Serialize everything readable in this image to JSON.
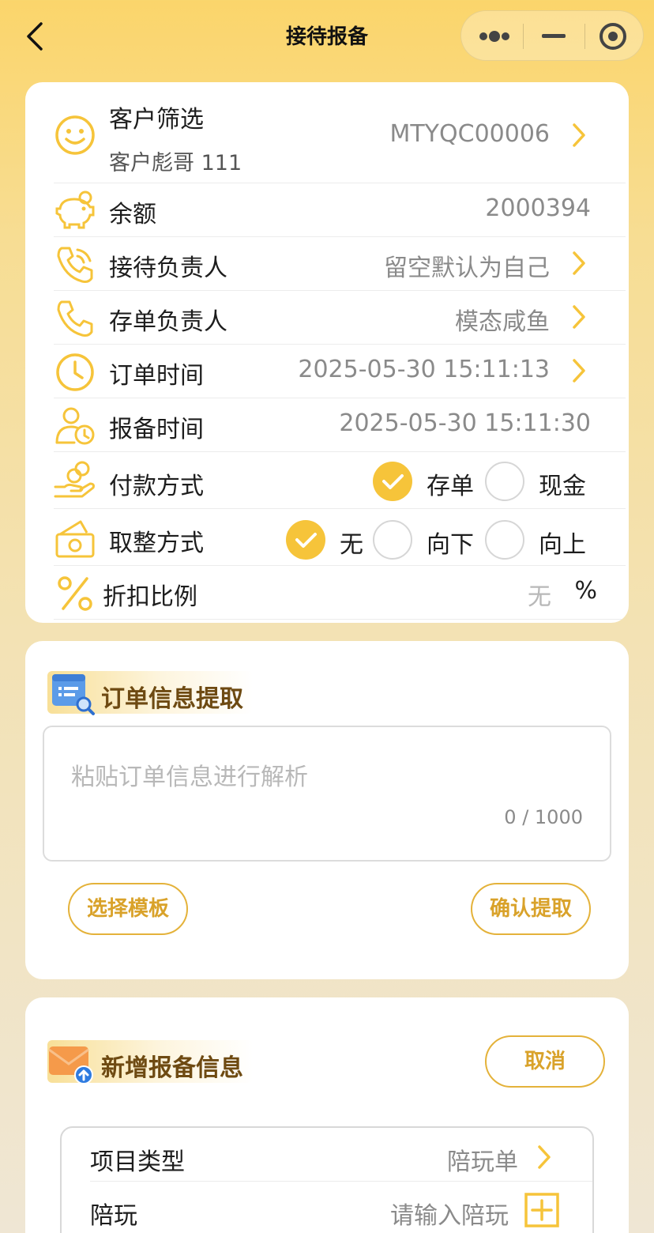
{
  "header": {
    "title": "接待报备",
    "back_icon": "chevron-left-icon",
    "menu_icons": [
      "more-dots-icon",
      "minimize-icon",
      "close-circle-icon"
    ]
  },
  "colors": {
    "accent": "#F6C43A",
    "accent_text": "#D9A22A",
    "section_title": "#6E4A12"
  },
  "customer": {
    "label": "客户筛选",
    "name": "客户彪哥 111",
    "code": "MTYQC00006"
  },
  "balance": {
    "label": "余额",
    "value": "2000394"
  },
  "reception_owner": {
    "label": "接待负责人",
    "value": "留空默认为自己"
  },
  "deposit_owner": {
    "label": "存单负责人",
    "value": "模态咸鱼"
  },
  "order_time": {
    "label": "订单时间",
    "value": "2025-05-30 15:11:13"
  },
  "report_time": {
    "label": "报备时间",
    "value": "2025-05-30 15:11:30"
  },
  "payment": {
    "label": "付款方式",
    "options": [
      "存单",
      "现金"
    ],
    "selected": "存单"
  },
  "rounding": {
    "label": "取整方式",
    "options": [
      "无",
      "向下",
      "向上"
    ],
    "selected": "无"
  },
  "discount": {
    "label": "折扣比例",
    "value": "无",
    "unit": "%"
  },
  "order_extract": {
    "title": "订单信息提取",
    "placeholder": "粘贴订单信息进行解析",
    "counter": "0 / 1000",
    "select_template": "选择模板",
    "confirm_extract": "确认提取"
  },
  "new_report": {
    "title": "新增报备信息",
    "cancel": "取消",
    "project_type": {
      "label": "项目类型",
      "value": "陪玩单"
    },
    "companion": {
      "label": "陪玩",
      "placeholder": "请输入陪玩"
    }
  }
}
